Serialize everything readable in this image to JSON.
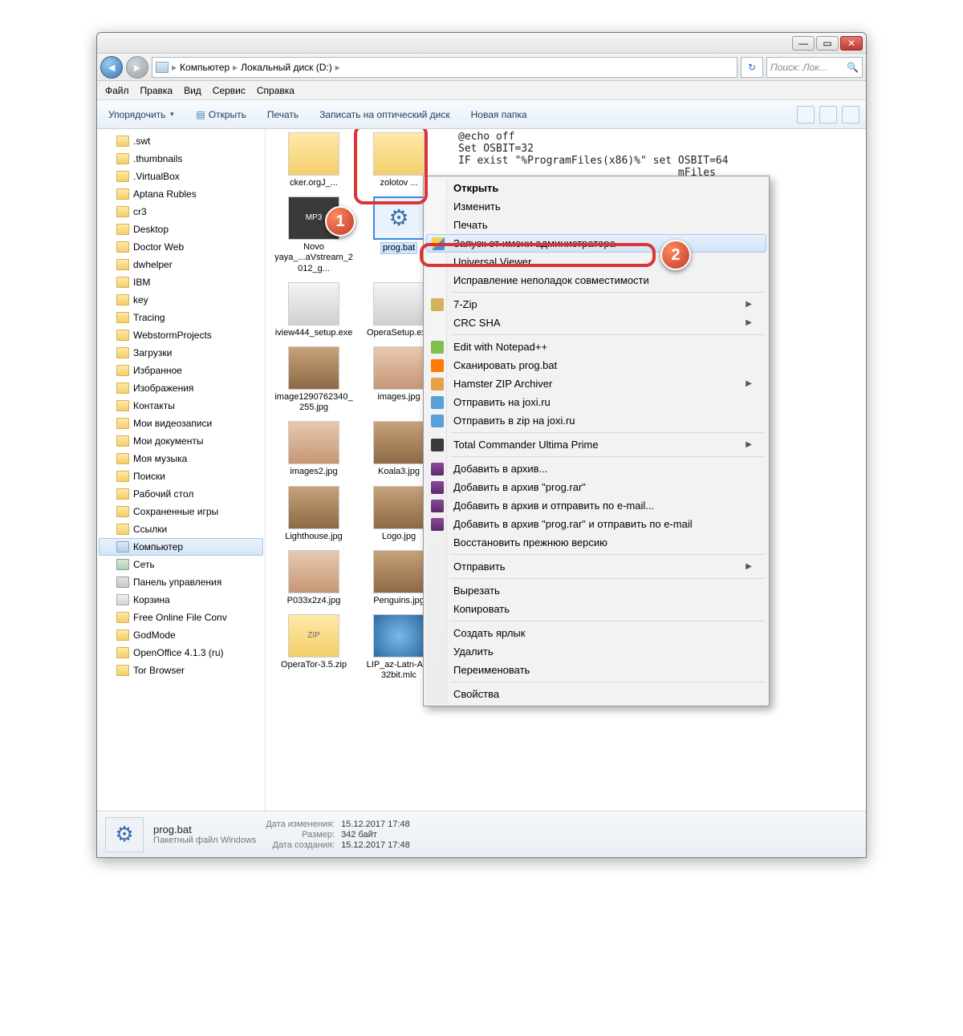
{
  "breadcrumb": {
    "root": "Компьютер",
    "path": "Локальный диск (D:)"
  },
  "search": {
    "placeholder": "Поиск: Лок..."
  },
  "menubar": [
    "Файл",
    "Правка",
    "Вид",
    "Сервис",
    "Справка"
  ],
  "toolbar": {
    "organize": "Упорядочить",
    "open": "Открыть",
    "print": "Печать",
    "burn": "Записать на оптический диск",
    "newfolder": "Новая папка"
  },
  "tree": {
    "folders": [
      ".swt",
      ".thumbnails",
      ".VirtualBox",
      "Aptana Rubles",
      "cr3",
      "Desktop",
      "Doctor Web",
      "dwhelper",
      "IBM",
      "key",
      "Tracing",
      "WebstormProjects",
      "Загрузки",
      "Избранное",
      "Изображения",
      "Контакты",
      "Мои видеозаписи",
      "Мои документы",
      "Моя музыка",
      "Поиски",
      "Рабочий стол",
      "Сохраненные игры",
      "Ссылки"
    ],
    "computer": "Компьютер",
    "network": "Сеть",
    "controlpanel": "Панель управления",
    "recyclebin": "Корзина",
    "extra": [
      "Free Online File Conv",
      "GodMode",
      "OpenOffice 4.1.3 (ru)",
      "Tor Browser"
    ]
  },
  "files": [
    {
      "name": "cker.orgJ_...",
      "thumb": "zip"
    },
    {
      "name": "zolotov ...",
      "thumb": "zip"
    },
    {
      "name": "Novo yaya_...aVstream_2012_g...",
      "thumb": "mp3",
      "badge": "MP3"
    },
    {
      "name": "prog.bat",
      "thumb": "gear",
      "selected": true
    },
    {
      "name": "iview444_setup.exe",
      "thumb": "exe"
    },
    {
      "name": "OperaSetup.exe",
      "thumb": "exe"
    },
    {
      "name": "image1290762340_255.jpg",
      "thumb": "img"
    },
    {
      "name": "images.jpg",
      "thumb": "face"
    },
    {
      "name": "images2.jpg",
      "thumb": "face"
    },
    {
      "name": "Koala3.jpg",
      "thumb": "img"
    },
    {
      "name": "Lighthouse.jpg",
      "thumb": "img"
    },
    {
      "name": "Logo.jpg",
      "thumb": "img"
    },
    {
      "name": "P033x2z4.jpg",
      "thumb": "face"
    },
    {
      "name": "Penguins.jpg",
      "thumb": "img"
    },
    {
      "name": "OperaTor-3.5.zip",
      "thumb": "zip",
      "badge": "ZIP"
    },
    {
      "name": "LIP_az-Latn-AZ-32bit.mlc",
      "thumb": "globe"
    }
  ],
  "preview": "@echo off\nSet OSBIT=32\nIF exist \"%ProgramFiles(x86)%\" set OSBIT=64\n                                   mFiles",
  "context": {
    "items": [
      {
        "label": "Открыть",
        "bold": true
      },
      {
        "label": "Изменить"
      },
      {
        "label": "Печать"
      },
      {
        "label": "Запуск от имени администратора",
        "icon": "shield",
        "hl": true
      },
      {
        "label": "Universal Viewer"
      },
      {
        "label": "Исправление неполадок совместимости"
      },
      {
        "sep": true
      },
      {
        "label": "7-Zip",
        "icon": "zip7",
        "sub": true
      },
      {
        "label": "CRC SHA",
        "sub": true
      },
      {
        "sep": true
      },
      {
        "label": "Edit with Notepad++",
        "icon": "npp"
      },
      {
        "label": "Сканировать prog.bat",
        "icon": "avast"
      },
      {
        "label": "Hamster ZIP Archiver",
        "icon": "hamster",
        "sub": true
      },
      {
        "label": "Отправить на joxi.ru",
        "icon": "joxi"
      },
      {
        "label": "Отправить в zip на joxi.ru",
        "icon": "joxi"
      },
      {
        "sep": true
      },
      {
        "label": "Total Commander Ultima Prime",
        "icon": "tc",
        "sub": true
      },
      {
        "sep": true
      },
      {
        "label": "Добавить в архив...",
        "icon": "rar"
      },
      {
        "label": "Добавить в архив \"prog.rar\"",
        "icon": "rar"
      },
      {
        "label": "Добавить в архив и отправить по e-mail...",
        "icon": "rar"
      },
      {
        "label": "Добавить в архив \"prog.rar\" и отправить по e-mail",
        "icon": "rar"
      },
      {
        "label": "Восстановить прежнюю версию"
      },
      {
        "sep": true
      },
      {
        "label": "Отправить",
        "sub": true
      },
      {
        "sep": true
      },
      {
        "label": "Вырезать"
      },
      {
        "label": "Копировать"
      },
      {
        "sep": true
      },
      {
        "label": "Создать ярлык"
      },
      {
        "label": "Удалить"
      },
      {
        "label": "Переименовать"
      },
      {
        "sep": true
      },
      {
        "label": "Свойства"
      }
    ]
  },
  "status": {
    "filename": "prog.bat",
    "filetype": "Пакетный файл Windows",
    "labels": {
      "modified": "Дата изменения:",
      "size": "Размер:",
      "created": "Дата создания:"
    },
    "modified": "15.12.2017 17:48",
    "size": "342 байт",
    "created": "15.12.2017 17:48"
  },
  "callouts": {
    "one": "1",
    "two": "2"
  }
}
